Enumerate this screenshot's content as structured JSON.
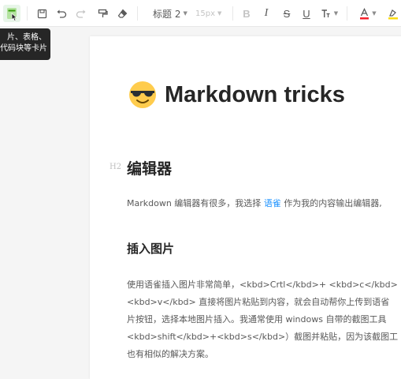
{
  "toolbar": {
    "heading_select": "标题 2",
    "font_size_select": "15px",
    "bold": "B",
    "italic": "I",
    "strike": "S",
    "underline": "U",
    "text_color": "A",
    "accent_color": "#f5222d",
    "highlight_color": "#fadb14"
  },
  "tooltip": {
    "line1": "片、表格、",
    "line2": "代码块等卡片"
  },
  "doc": {
    "title": "Markdown tricks",
    "h2_marker": "H2",
    "h2": "编辑器",
    "p1_before": "Markdown 编辑器有很多，我选择 ",
    "p1_link": "语雀",
    "p1_after": " 作为我的内容输出编辑器,",
    "h3": "插入图片",
    "p2_lines": [
      "使用语雀插入图片非常简单，<kbd>Crtl</kbd>+ <kbd>c</kbd>",
      "<kbd>v</kbd> 直接将图片粘贴到内容，就会自动帮你上传到语省",
      "片按钮，选择本地图片插入。我通常使用 windows 自带的截图工具",
      "<kbd>shift</kbd>+<kbd>s</kbd>）截图并粘贴，因为该截图工",
      "也有相似的解决方案。"
    ]
  }
}
